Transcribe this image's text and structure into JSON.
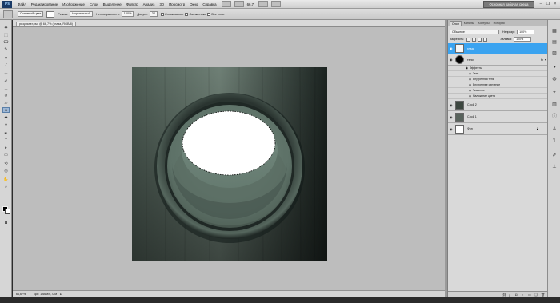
{
  "menubar": {
    "logo": "Ps",
    "items": [
      "Файл",
      "Редактирование",
      "Изображение",
      "Слои",
      "Выделение",
      "Фильтр",
      "Анализ",
      "3D",
      "Просмотр",
      "Окно",
      "Справка"
    ],
    "zoom": "66,7",
    "workspace": "Основная рабочая среда"
  },
  "optbar": {
    "source": "Основной цвет",
    "mode_label": "Режим:",
    "mode": "Нормальный",
    "opacity_label": "Непрозрачность:",
    "opacity": "100%",
    "tolerance_label": "Допуск:",
    "tolerance": "32",
    "antialias": "Сглаживание",
    "contiguous": "Смежн.пикс",
    "all_layers": "Все слои"
  },
  "document": {
    "tab": "результат.psd @ 66,7% (глаза, RGB/8)",
    "close": "×",
    "zoom": "66,67%",
    "info": "Док: 1,66M/6,72M",
    "arrow": "▸"
  },
  "layers_panel": {
    "tabs": [
      "Слои",
      "Каналы",
      "Контуры",
      "История"
    ],
    "blend_mode": "Обычные",
    "opacity_label": "Непрозр.:",
    "opacity": "100%",
    "lock_label": "Закрепить:",
    "fill_label": "Заливка:",
    "fill": "100%",
    "layers": [
      {
        "name": "глаза",
        "selected": true,
        "thumb": "#f6f6f6"
      },
      {
        "name": "тени",
        "selected": false,
        "thumb": "#000000",
        "fx": "fx"
      },
      {
        "name": "Слой 2",
        "selected": false,
        "thumb": "#3d4740"
      },
      {
        "name": "Слой 1",
        "selected": false,
        "thumb": "#58635c"
      },
      {
        "name": "Фон",
        "selected": false,
        "thumb": "#ffffff",
        "locked": true
      }
    ],
    "effects_label": "Эффекты",
    "effects": [
      "Тень",
      "Внутренняя тень",
      "Внутреннее свечение",
      "Тиснение",
      "Наложение цвета"
    ]
  },
  "colors": {
    "selection_blue": "#3aa3f0",
    "canvas_dark": "#1f2a25",
    "canvas_mid": "#5a6b62",
    "glass": "#7c9387"
  }
}
